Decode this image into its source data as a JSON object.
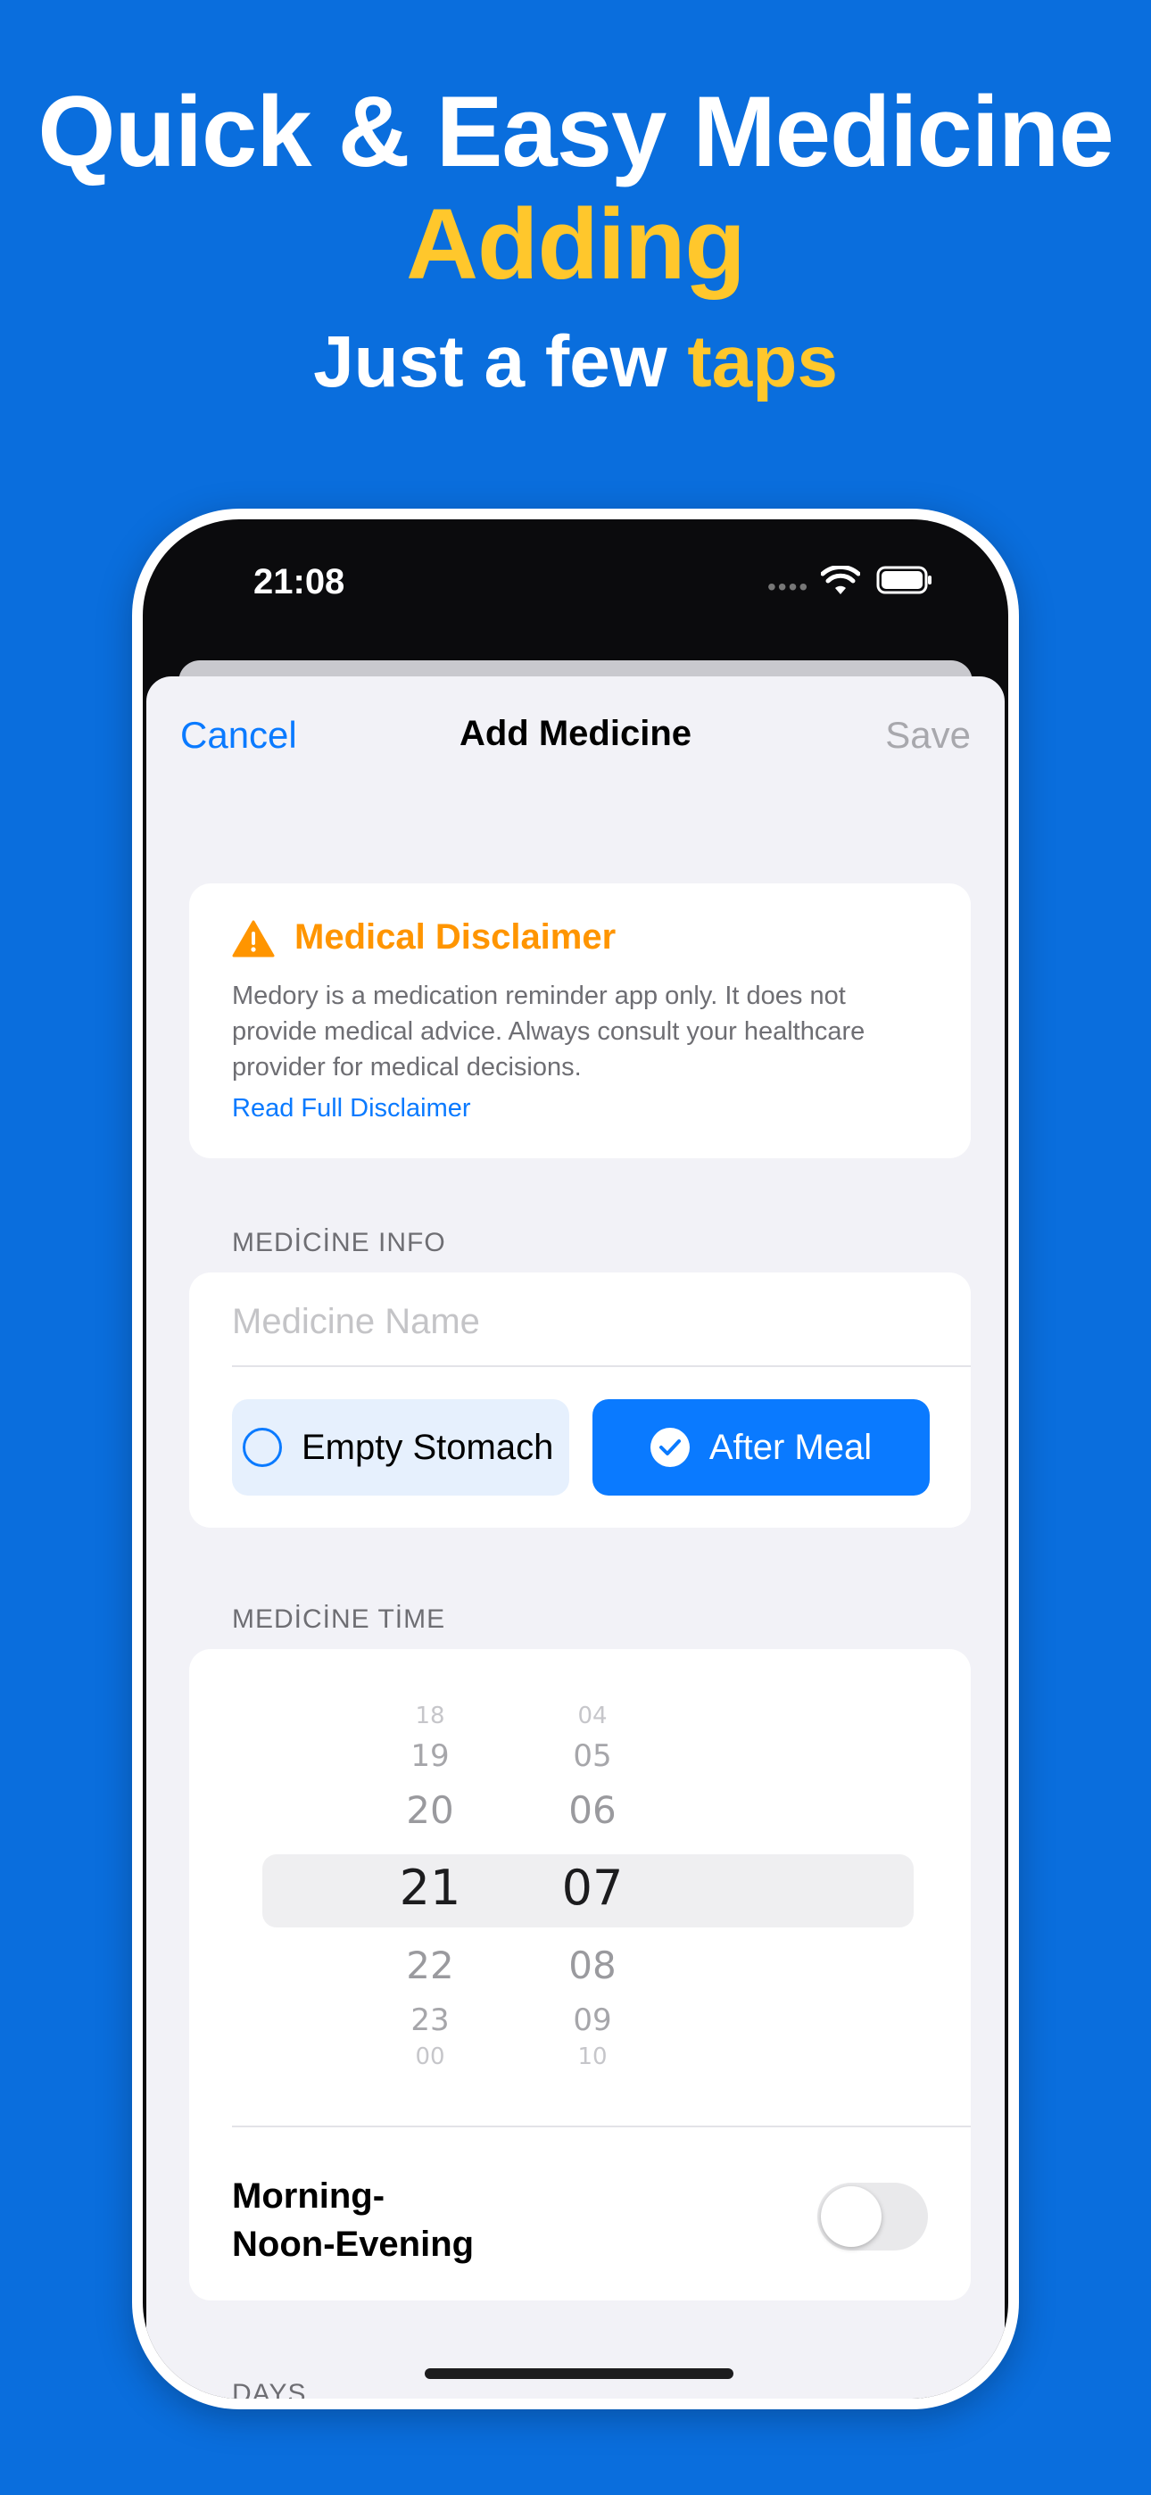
{
  "promo": {
    "line1": "Quick & Easy Medicine",
    "line2": "Adding",
    "line3_prefix": "Just a few ",
    "line3_accent": "taps"
  },
  "status_bar": {
    "time": "21:08",
    "icons": [
      "signal-dots-icon",
      "wifi-icon",
      "battery-icon"
    ]
  },
  "nav": {
    "cancel": "Cancel",
    "title": "Add Medicine",
    "save": "Save"
  },
  "disclaimer": {
    "title": "Medical Disclaimer",
    "body": "Medory is a medication reminder app only. It does not provide medical advice. Always consult your healthcare provider for medical decisions.",
    "link": "Read Full Disclaimer",
    "icon": "warning-icon"
  },
  "medicine_info": {
    "header": "MEDİCİNE INFO",
    "name_placeholder": "Medicine Name",
    "name_value": "",
    "options": [
      {
        "label": "Empty Stomach",
        "selected": false
      },
      {
        "label": "After Meal",
        "selected": true
      }
    ]
  },
  "medicine_time": {
    "header": "MEDİCİNE TİME",
    "hours": [
      "18",
      "19",
      "20",
      "21",
      "22",
      "23",
      "00"
    ],
    "minutes": [
      "04",
      "05",
      "06",
      "07",
      "08",
      "09",
      "10"
    ],
    "selected_hour": "21",
    "selected_minute": "07",
    "repeat_label": "Morning-Noon-Evening",
    "repeat_label_line1": "Morning-",
    "repeat_label_line2": "Noon-Evening",
    "repeat_enabled": false
  },
  "days": {
    "header": "DAYS"
  },
  "colors": {
    "background": "#0A6EDD",
    "accent_yellow": "#FFC72C",
    "ios_blue": "#0A7AFF",
    "warning_orange": "#FF9500"
  }
}
